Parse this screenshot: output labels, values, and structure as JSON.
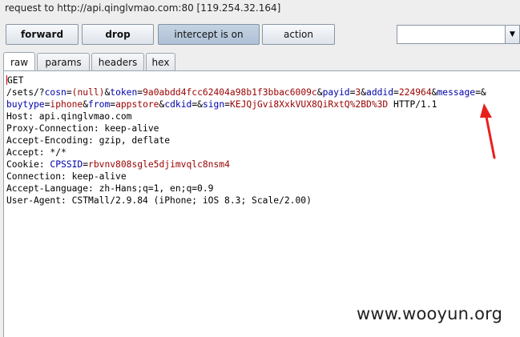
{
  "window": {
    "title": "request to http://api.qinglvmao.com:80  [119.254.32.164]"
  },
  "toolbar": {
    "forward_label": "forward",
    "drop_label": "drop",
    "intercept_label": "intercept is on",
    "action_label": "action",
    "dropdown_value": "",
    "dropdown_icon": "chevron-down-icon"
  },
  "tabs": [
    {
      "label": "raw",
      "active": true
    },
    {
      "label": "params",
      "active": false
    },
    {
      "label": "headers",
      "active": false
    },
    {
      "label": "hex",
      "active": false
    }
  ],
  "request": {
    "method": "GET",
    "path_prefix": "/sets/?",
    "params": [
      {
        "key": "cosn",
        "value": "(null)"
      },
      {
        "key": "token",
        "value": "9a0abdd4fcc62404a98b1f3bbac6009c"
      },
      {
        "key": "payid",
        "value": "3"
      },
      {
        "key": "addid",
        "value": "224964"
      },
      {
        "key": "message",
        "value": ""
      },
      {
        "key": "buytype",
        "value": "iphone"
      },
      {
        "key": "from",
        "value": "appstore"
      },
      {
        "key": "cdkid",
        "value": ""
      },
      {
        "key": "sign",
        "value": "KEJQjGvi8XxkVUX8QiRxtQ%2BD%3D"
      }
    ],
    "protocol": "HTTP/1.1",
    "headers": [
      "Host: api.qinglvmao.com",
      "Proxy-Connection: keep-alive",
      "Accept-Encoding: gzip, deflate",
      "Accept: */*"
    ],
    "cookie": {
      "name_label": "Cookie: ",
      "key": "CPSSID",
      "value": "rbvnv808sgle5djimvqlc8nsm4"
    },
    "headers_after": [
      "Connection: keep-alive",
      "Accept-Language: zh-Hans;q=1, en;q=0.9",
      "User-Agent: CSTMall/2.9.84 (iPhone; iOS 8.3; Scale/2.00)"
    ]
  },
  "annotation": {
    "color": "#e8201c"
  },
  "watermark": "www.wooyun.org"
}
